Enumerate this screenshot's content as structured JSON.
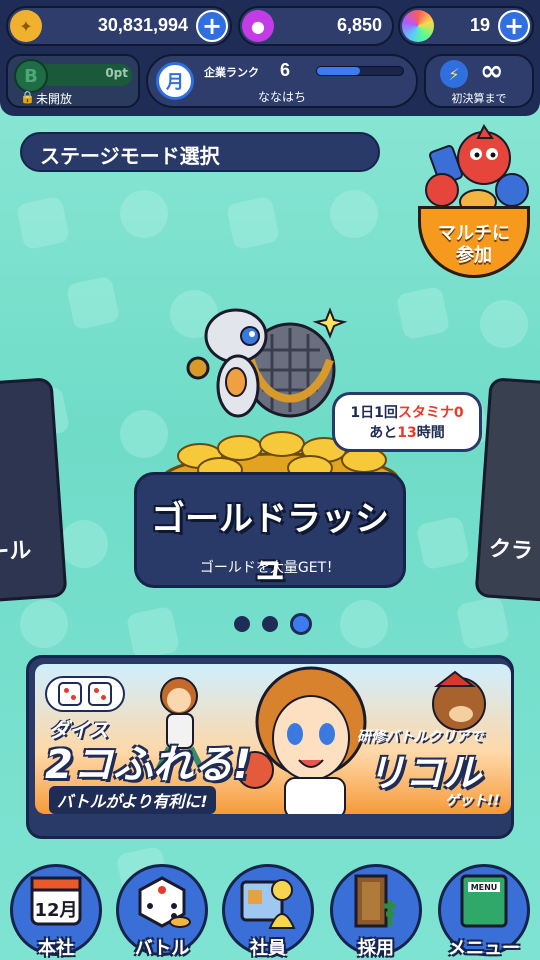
{
  "resources": {
    "gold": {
      "value": "30,831,994",
      "icon": "gold-coin-icon",
      "color": "#f0b12e"
    },
    "gem": {
      "value": "6,850",
      "icon": "purple-drop-icon",
      "color": "#c43ce6"
    },
    "orb": {
      "value": "19",
      "icon": "rainbow-orb-icon"
    }
  },
  "b_rank": {
    "points": "0pt",
    "locked_label": "未開放"
  },
  "company_rank": {
    "label": "企業ランク",
    "value": "6",
    "name": "ななはち",
    "progress": 0.5
  },
  "stamina": {
    "value": "∞",
    "label": "初決算まで"
  },
  "stage_title": "ステージモード選択",
  "multi": {
    "line1": "マルチに",
    "line2": "参加"
  },
  "daily_badge": {
    "line1_a": "1日1回",
    "line1_b": "スタミナ0",
    "line2_a": "あと",
    "line2_b": "13",
    "line2_c": "時間"
  },
  "rush": {
    "title": "ゴールドラッシュ",
    "subtitle": "ゴールドを大量GET！"
  },
  "side_left_label": "ール",
  "side_right_label": "クラ",
  "pager": {
    "count": 3,
    "active": 2
  },
  "banner": {
    "dice_word": "ダイス",
    "big_text": "2コふれる!",
    "small_text": "バトルがより有利に!",
    "right_top": "研修バトルクリアで",
    "right_big": "リコル",
    "right_get": "ゲット!!"
  },
  "nav": {
    "items": [
      {
        "label": "本社",
        "icon": "calendar-icon",
        "month": "12月"
      },
      {
        "label": "バトル",
        "icon": "dice-icon"
      },
      {
        "label": "社員",
        "icon": "employee-card-icon"
      },
      {
        "label": "採用",
        "icon": "door-icon"
      },
      {
        "label": "メニュー",
        "icon": "menu-book-icon",
        "book_text": "MENU"
      }
    ]
  }
}
